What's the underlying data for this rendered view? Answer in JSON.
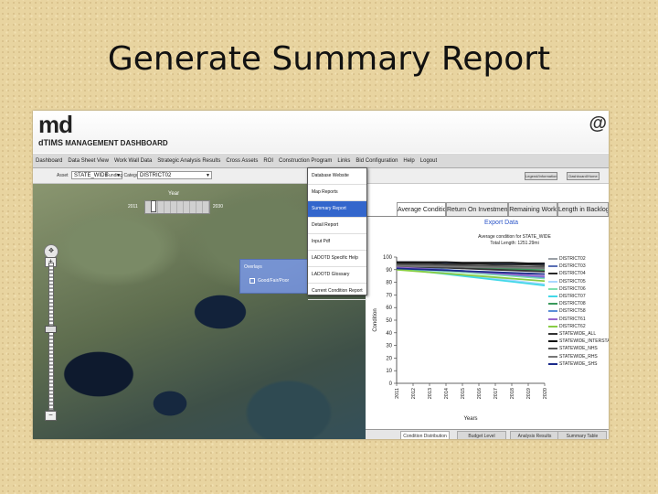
{
  "slide": {
    "title": "Generate Summary Report"
  },
  "app": {
    "logo": "md",
    "logo_sub_prefix": "dTIMS",
    "logo_sub_main": "MANAGEMENT DASHBOARD",
    "corner_logo": "@"
  },
  "nav": {
    "items": [
      "Dashboard",
      "Data Sheet View",
      "Work Wall Data",
      "Strategic Analysis Results",
      "Cross Assets",
      "ROI",
      "Construction Program",
      "Links",
      "Bid Configuration",
      "Help",
      "Logout"
    ]
  },
  "toolbar": {
    "asset_label": "Asset",
    "asset_value": "STATE_WIDE",
    "category_label": "Funding Category",
    "category_value": "DISTRICT02",
    "button1": "Legend/Information",
    "button2": "Dashboard/Home"
  },
  "map": {
    "year_label": "Year",
    "year_start": "2011",
    "year_end": "2030",
    "year_fraction": 0.1,
    "zoom_level_fraction": 0.45,
    "overlay_title": "Overlays",
    "overlay_option": "Good/Fair/Poor"
  },
  "dropdown": {
    "items": [
      "Database Website",
      "Map Reports",
      "Summary Report",
      "Detail Report",
      "Input Pdf",
      "LADOTD Specific Help",
      "LADOTD Glossary",
      "Current Condition Report"
    ],
    "active_index": 2
  },
  "tabs": {
    "items": [
      "Average Condition",
      "Return On Investment",
      "Remaining Work",
      "Length in Backlog"
    ],
    "active_index": 0
  },
  "export_label": "Export Data",
  "bottom_tabs": [
    "Condition Distribution",
    "Budget Level",
    "Analysis Results",
    "Summary Table"
  ],
  "chart_data": {
    "type": "line",
    "title": "Average condition for STATE_WIDE",
    "subtitle": "Total Length: 1251.29mi",
    "xlabel": "Years",
    "ylabel": "Condition",
    "x": [
      2011,
      2012,
      2013,
      2014,
      2015,
      2016,
      2017,
      2018,
      2019,
      2020
    ],
    "xlim": [
      2011,
      2020
    ],
    "ylim": [
      0,
      100
    ],
    "yticks": [
      0,
      10,
      20,
      30,
      40,
      50,
      60,
      70,
      80,
      90,
      100
    ],
    "grid": false,
    "legend_position": "right",
    "series": [
      {
        "name": "DISTRICT02",
        "color": "#9aa0a6",
        "values": [
          95,
          94.5,
          94,
          93.5,
          93,
          92.5,
          92,
          91.5,
          91,
          90.5
        ]
      },
      {
        "name": "DISTRICT03",
        "color": "#5a6fb5",
        "values": [
          96,
          96,
          95.5,
          95.5,
          95,
          95,
          94.5,
          94.5,
          94,
          94
        ]
      },
      {
        "name": "DISTRICT04",
        "color": "#2a2a2a",
        "values": [
          95,
          95,
          95,
          94.5,
          94.5,
          94.5,
          94,
          94,
          94,
          93.5
        ]
      },
      {
        "name": "DISTRICT05",
        "color": "#a8d8ff",
        "values": [
          92,
          90.5,
          89,
          87.5,
          86,
          84.5,
          83,
          81.5,
          80,
          78.5
        ]
      },
      {
        "name": "DISTRICT06",
        "color": "#7fe0b0",
        "values": [
          92,
          91,
          90,
          89,
          88,
          87,
          86,
          85,
          84,
          83
        ]
      },
      {
        "name": "DISTRICT07",
        "color": "#42d8e8",
        "values": [
          91,
          89.5,
          88,
          86.5,
          85,
          83.5,
          82,
          80.5,
          79,
          77.5
        ]
      },
      {
        "name": "DISTRICT08",
        "color": "#3a9a5c",
        "values": [
          94,
          93.5,
          93,
          92.5,
          92,
          91.5,
          91,
          90.5,
          90,
          89.5
        ]
      },
      {
        "name": "DISTRICT58",
        "color": "#5b8fd8",
        "values": [
          93,
          92,
          91,
          90,
          89,
          88,
          87,
          86,
          85,
          84
        ]
      },
      {
        "name": "DISTRICT61",
        "color": "#9966cc",
        "values": [
          92,
          91.2,
          90.4,
          89.6,
          88.8,
          88,
          87.2,
          86.4,
          85.6,
          84.8
        ]
      },
      {
        "name": "DISTRICT62",
        "color": "#88cc44",
        "values": [
          90,
          89,
          88,
          87,
          86,
          85,
          84,
          83,
          82,
          81
        ]
      },
      {
        "name": "STATEWIDE_ALL",
        "color": "#333333",
        "values": [
          93,
          92.5,
          92,
          91.5,
          91,
          90.5,
          90,
          89.5,
          89,
          88.5
        ]
      },
      {
        "name": "STATEWIDE_INTERSTATE",
        "color": "#111111",
        "values": [
          96,
          96,
          96,
          96,
          95.5,
          95.5,
          95.5,
          95.5,
          95,
          95
        ]
      },
      {
        "name": "STATEWIDE_NHS",
        "color": "#555555",
        "values": [
          94,
          93.8,
          93.6,
          93.4,
          93.2,
          93,
          92.8,
          92.6,
          92.4,
          92.2
        ]
      },
      {
        "name": "STATEWIDE_RHS",
        "color": "#777777",
        "values": [
          93,
          92.8,
          92.6,
          92.4,
          92.2,
          92,
          91.8,
          91.6,
          91.4,
          91.2
        ]
      },
      {
        "name": "STATEWIDE_SHS",
        "color": "#1a2a8a",
        "values": [
          91,
          90.5,
          90,
          89.5,
          89,
          88.5,
          88,
          87.5,
          87,
          86.5
        ]
      }
    ]
  }
}
